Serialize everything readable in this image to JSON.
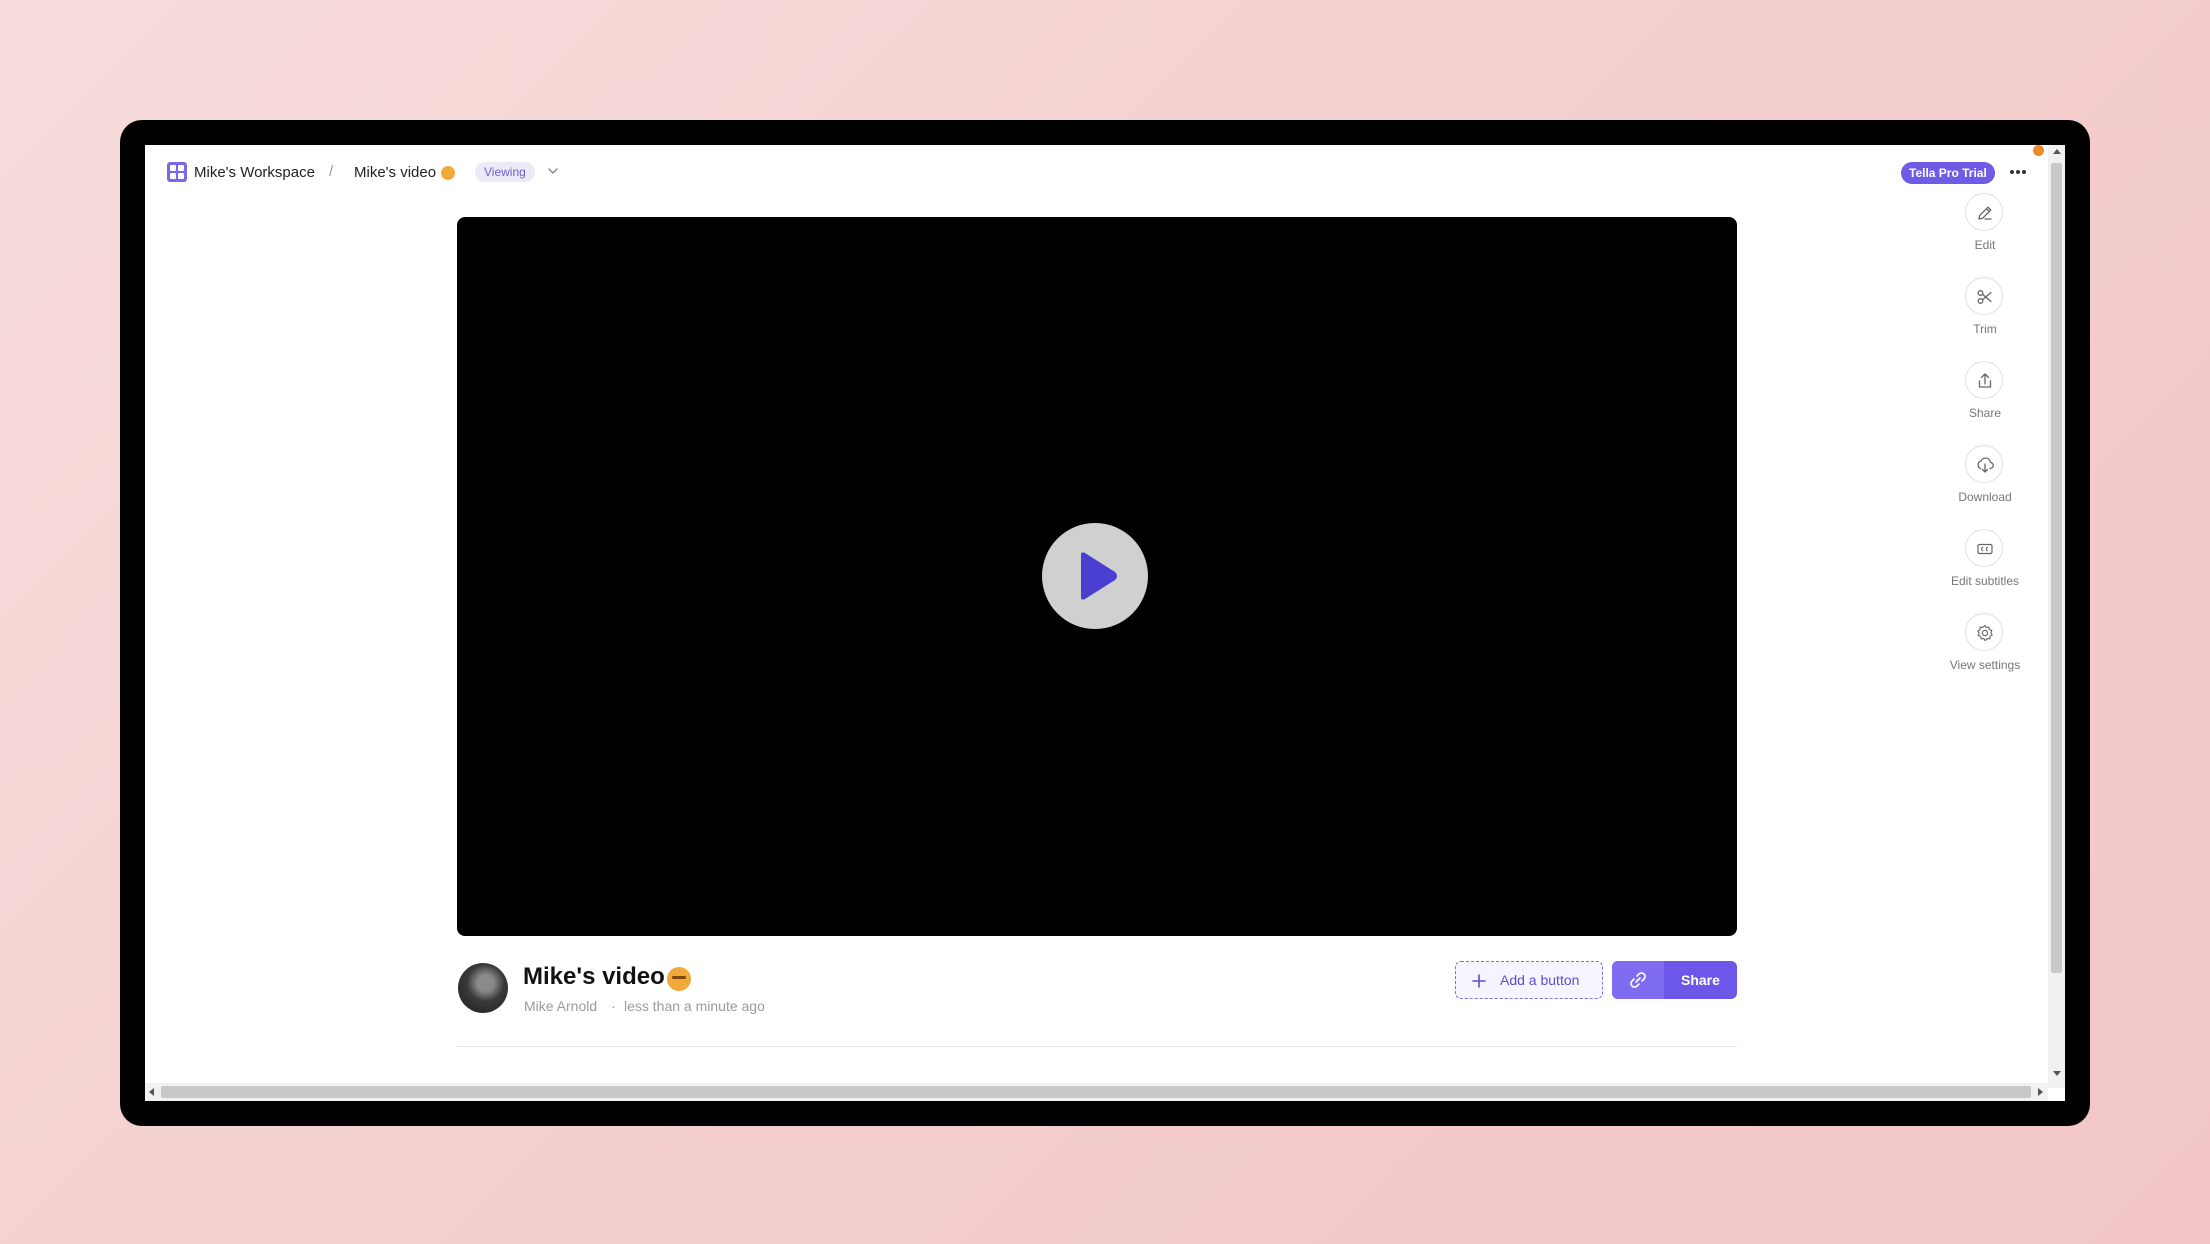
{
  "breadcrumb": {
    "workspace": "Mike's Workspace",
    "separator": "/",
    "video_title": "Mike's video",
    "mode": "Viewing"
  },
  "header": {
    "trial_badge": "Tella Pro Trial",
    "more_icon": "more-horizontal-icon"
  },
  "video": {
    "play_icon": "play-icon"
  },
  "info": {
    "title": "Mike's video",
    "author": "Mike Arnold",
    "separator": "·",
    "timestamp": "less than a minute ago",
    "add_button_label": "Add a button",
    "share_button_label": "Share"
  },
  "actions": [
    {
      "label": "Edit",
      "icon": "pencil-icon"
    },
    {
      "label": "Trim",
      "icon": "scissors-icon"
    },
    {
      "label": "Share",
      "icon": "share-icon"
    },
    {
      "label": "Download",
      "icon": "download-icon"
    },
    {
      "label": "Edit subtitles",
      "icon": "captions-icon"
    },
    {
      "label": "View settings",
      "icon": "gear-icon"
    }
  ],
  "colors": {
    "accent": "#6b57e8",
    "badge_bg": "#6e5ce6",
    "emoji": "#f2a93b",
    "notification": "#f08a24"
  }
}
